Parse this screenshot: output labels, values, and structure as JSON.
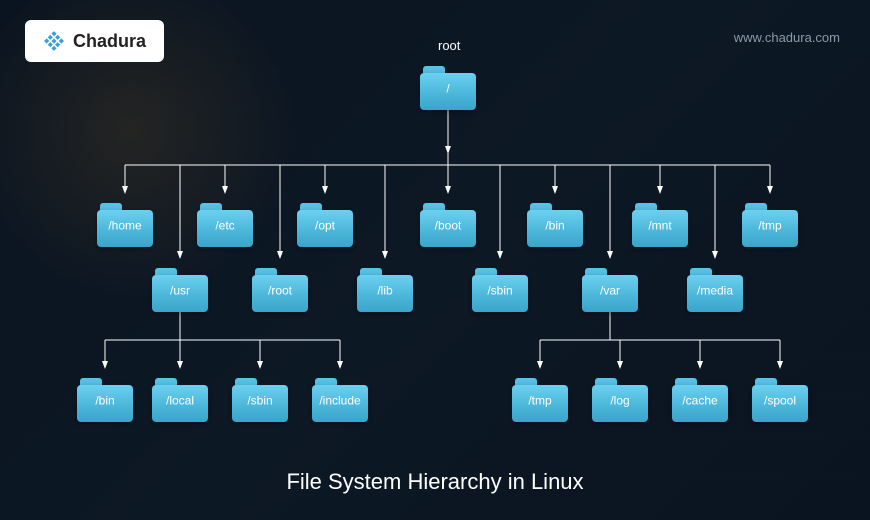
{
  "brand": {
    "name": "Chadura",
    "url": "www.chadura.com"
  },
  "title": "File System Hierarchy in Linux",
  "root": {
    "pretext": "root",
    "label": "/"
  },
  "level1_row1": [
    {
      "label": "/home"
    },
    {
      "label": "/etc"
    },
    {
      "label": "/opt"
    },
    {
      "label": "/boot"
    },
    {
      "label": "/bin"
    },
    {
      "label": "/mnt"
    },
    {
      "label": "/tmp"
    }
  ],
  "level1_row2": [
    {
      "label": "/usr"
    },
    {
      "label": "/root"
    },
    {
      "label": "/lib"
    },
    {
      "label": "/sbin"
    },
    {
      "label": "/var"
    },
    {
      "label": "/media"
    }
  ],
  "usr_children": [
    {
      "label": "/bin"
    },
    {
      "label": "/local"
    },
    {
      "label": "/sbin"
    },
    {
      "label": "/include"
    }
  ],
  "var_children": [
    {
      "label": "/tmp"
    },
    {
      "label": "/log"
    },
    {
      "label": "/cache"
    },
    {
      "label": "/spool"
    }
  ]
}
